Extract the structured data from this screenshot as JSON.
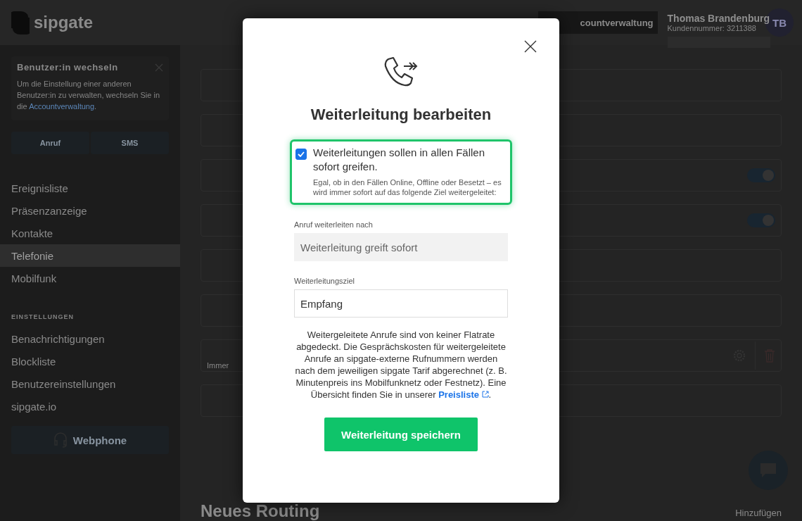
{
  "header": {
    "logo": "sipgate",
    "account_button": "countverwaltung",
    "user_name": "Thomas Brandenburg",
    "customer_number": "Kundennummer: 3211388",
    "avatar": "TB"
  },
  "sidebar": {
    "notice": {
      "title": "Benutzer:in wechseln",
      "text": "Um die Einstellung einer anderen Benutzer:in zu verwalten, wechseln Sie in die",
      "link": "Accountverwaltung",
      "end": "."
    },
    "actions": [
      "Anruf",
      "SMS"
    ],
    "nav": [
      {
        "label": "Ereignisliste",
        "selected": false
      },
      {
        "label": "Präsenzanzeige",
        "selected": false
      },
      {
        "label": "Kontakte",
        "selected": false
      },
      {
        "label": "Telefonie",
        "selected": true
      },
      {
        "label": "Mobilfunk",
        "selected": false
      }
    ],
    "section_title": "EINSTELLUNGEN",
    "settings": [
      {
        "label": "Benachrichtigungen",
        "selected": false
      },
      {
        "label": "Blockliste",
        "selected": false
      },
      {
        "label": "Benutzereinstellungen",
        "selected": false
      },
      {
        "label": "sipgate.io",
        "selected": false
      }
    ],
    "webphone": "Webphone"
  },
  "content": {
    "rows": [
      {
        "kind": "plain"
      },
      {
        "kind": "plain"
      },
      {
        "kind": "toggle",
        "on": true
      },
      {
        "kind": "toggle",
        "on": true
      },
      {
        "kind": "plain"
      },
      {
        "kind": "plain"
      },
      {
        "kind": "actions",
        "label": "Immer"
      },
      {
        "kind": "plain"
      }
    ],
    "heading": "Neues Routing",
    "add_button": "Hinzufügen"
  },
  "modal": {
    "title": "Weiterleitung bearbeiten",
    "option": {
      "checked": true,
      "label": "Weiterleitungen sollen in allen Fällen sofort greifen.",
      "description": "Egal, ob in den Fällen Online, Offline oder Besetzt – es wird immer sofort auf das folgende Ziel weitergeleitet:"
    },
    "fields": [
      {
        "label": "Anruf weiterleiten nach",
        "value": "Weiterleitung greift sofort",
        "disabled": true
      },
      {
        "label": "Weiterleitungsziel",
        "value": "Empfang",
        "disabled": false
      }
    ],
    "note": {
      "text": "Weitergeleitete Anrufe sind von keiner Flatrate abgedeckt. Die Gesprächskosten für weitergeleitete Anrufe an sipgate-externe Rufnummern werden nach dem jeweiligen sipgate Tarif abgerechnet (z. B. Minutenpreis ins Mobilfunknetz oder Festnetz). Eine Übersicht finden Sie in unserer",
      "link": "Preisliste",
      "end": "."
    },
    "save_button": "Weiterleitung speichern"
  }
}
